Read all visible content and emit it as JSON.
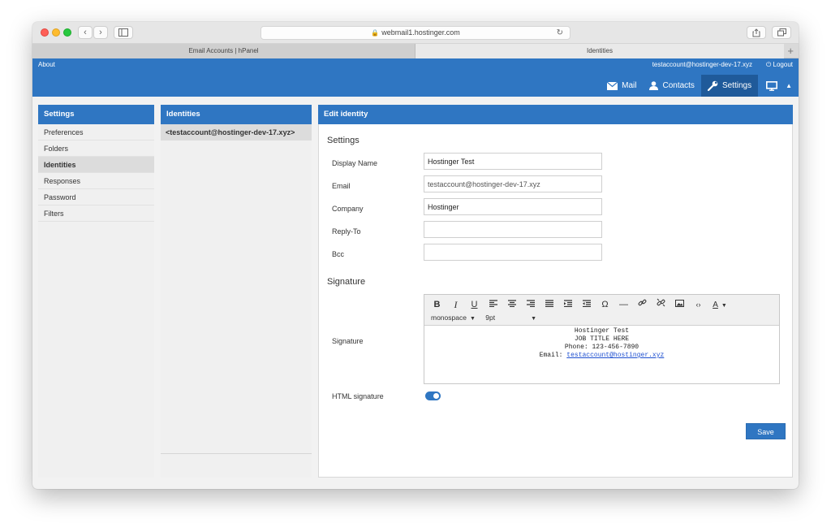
{
  "browser": {
    "url": "webmail1.hostinger.com",
    "tabs": [
      {
        "label": "Email Accounts | hPanel"
      },
      {
        "label": "Identities"
      }
    ],
    "new_tab_symbol": "+"
  },
  "header": {
    "about": "About",
    "account": "testaccount@hostinger-dev-17.xyz",
    "logout": "Logout",
    "nav": [
      {
        "label": "Mail",
        "icon": "envelope-icon"
      },
      {
        "label": "Contacts",
        "icon": "person-icon"
      },
      {
        "label": "Settings",
        "icon": "wrench-icon",
        "active": true
      }
    ]
  },
  "settings_panel": {
    "title": "Settings",
    "items": [
      {
        "label": "Preferences"
      },
      {
        "label": "Folders"
      },
      {
        "label": "Identities",
        "selected": true
      },
      {
        "label": "Responses"
      },
      {
        "label": "Password"
      },
      {
        "label": "Filters"
      }
    ]
  },
  "identities_panel": {
    "title": "Identities",
    "items": [
      {
        "label": "<testaccount@hostinger-dev-17.xyz>"
      }
    ]
  },
  "edit_identity": {
    "title": "Edit identity",
    "settings_heading": "Settings",
    "fields": {
      "display_name": {
        "label": "Display Name",
        "value": "Hostinger Test"
      },
      "email": {
        "label": "Email",
        "value": "testaccount@hostinger-dev-17.xyz"
      },
      "company": {
        "label": "Company",
        "value": "Hostinger"
      },
      "reply_to": {
        "label": "Reply-To",
        "value": ""
      },
      "bcc": {
        "label": "Bcc",
        "value": ""
      }
    },
    "signature_heading": "Signature",
    "signature_label": "Signature",
    "editor": {
      "font": "monospace",
      "size": "9pt",
      "lines": {
        "name": "Hostinger Test",
        "job": "JOB TITLE HERE",
        "phone": "Phone: 123-456-7890",
        "email_prefix": "Email:",
        "email_link": "testaccount@hostinger.xyz"
      }
    },
    "html_signature_label": "HTML signature",
    "html_signature_on": true,
    "save_label": "Save"
  },
  "colors": {
    "accent": "#2f76c2",
    "accent_dark": "#1f5a9a",
    "link": "#1d4fd0"
  }
}
